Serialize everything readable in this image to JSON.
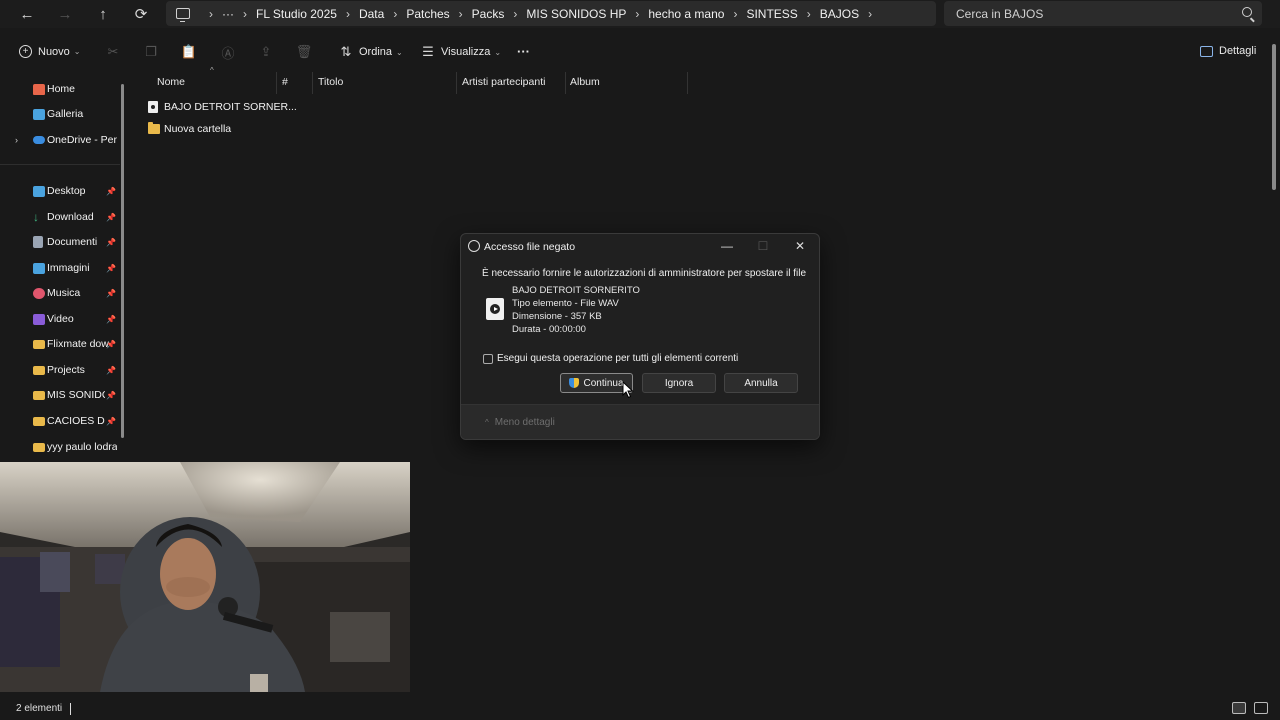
{
  "address_bar": {
    "breadcrumbs": [
      "FL Studio 2025",
      "Data",
      "Patches",
      "Packs",
      "MIS SONIDOS HP",
      "hecho a mano",
      "SINTESS",
      "BAJOS"
    ],
    "overflow": "···",
    "search_placeholder": "Cerca in BAJOS"
  },
  "toolbar": {
    "new_label": "Nuovo",
    "sort_label": "Ordina",
    "view_label": "Visualizza",
    "more_label": "···",
    "details_label": "Dettagli"
  },
  "sidebar": {
    "items": [
      {
        "label": "Home",
        "icon": "home-icon",
        "color": "#e8664a"
      },
      {
        "label": "Galleria",
        "icon": "gallery-icon",
        "color": "#4aa3df"
      },
      {
        "label": "OneDrive - Perso",
        "icon": "cloud-icon",
        "color": "#3a8de0"
      },
      {
        "label": "Desktop",
        "icon": "desktop-icon",
        "color": "#4aa3df"
      },
      {
        "label": "Download",
        "icon": "download-icon",
        "color": "#3fb27f"
      },
      {
        "label": "Documenti",
        "icon": "documents-icon",
        "color": "#9aa5b4"
      },
      {
        "label": "Immagini",
        "icon": "pictures-icon",
        "color": "#4aa3df"
      },
      {
        "label": "Musica",
        "icon": "music-icon",
        "color": "#e0566d"
      },
      {
        "label": "Video",
        "icon": "video-icon",
        "color": "#8a5cd8"
      },
      {
        "label": "Flixmate dow",
        "icon": "folder-icon",
        "color": "#e9b94a"
      },
      {
        "label": "Projects",
        "icon": "folder-icon",
        "color": "#e9b94a"
      },
      {
        "label": "MIS SONIDOS",
        "icon": "folder-icon",
        "color": "#e9b94a"
      },
      {
        "label": "CACIOES DJ",
        "icon": "folder-icon",
        "color": "#e9b94a"
      },
      {
        "label": "yyy paulo lodra",
        "icon": "folder-icon",
        "color": "#e9b94a"
      }
    ]
  },
  "file_list": {
    "columns": [
      "Nome",
      "#",
      "Titolo",
      "Artisti partecipanti",
      "Album"
    ],
    "rows": [
      {
        "name": "BAJO DETROIT SORNER...",
        "icon": "audio-file-icon"
      },
      {
        "name": "Nuova cartella",
        "icon": "folder-icon"
      }
    ]
  },
  "dialog": {
    "title": "Accesso file negato",
    "message": "È necessario fornire le autorizzazioni di amministratore per spostare il file",
    "file_name": "BAJO DETROIT SORNERITO",
    "file_type": "Tipo elemento - File WAV",
    "file_size": "Dimensione - 357 KB",
    "file_duration": "Durata - 00:00:00",
    "checkbox_label": "Esegui questa operazione per tutti gli elementi correnti",
    "checkbox_checked": false,
    "continue_label": "Continua",
    "skip_label": "Ignora",
    "cancel_label": "Annulla",
    "less_details_label": "Meno dettagli"
  },
  "status_bar": {
    "item_count": "2 elementi"
  }
}
